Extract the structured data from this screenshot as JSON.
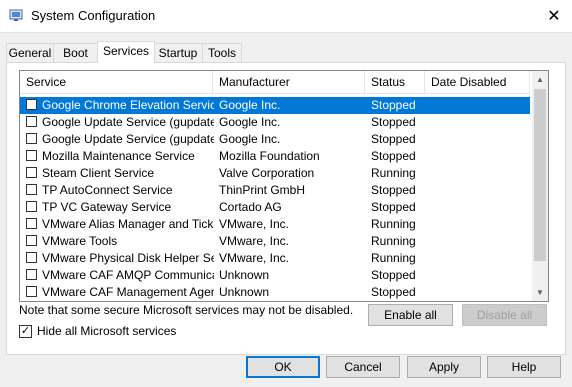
{
  "window": {
    "title": "System Configuration",
    "close_glyph": "✕"
  },
  "tabs": [
    {
      "label": "General"
    },
    {
      "label": "Boot"
    },
    {
      "label": "Services"
    },
    {
      "label": "Startup"
    },
    {
      "label": "Tools"
    }
  ],
  "active_tab": "Services",
  "table": {
    "columns": [
      "Service",
      "Manufacturer",
      "Status",
      "Date Disabled"
    ],
    "rows": [
      {
        "service": "Google Chrome Elevation Service",
        "manufacturer": "Google Inc.",
        "status": "Stopped",
        "date": "",
        "checked": false,
        "selected": true
      },
      {
        "service": "Google Update Service (gupdate)",
        "manufacturer": "Google Inc.",
        "status": "Stopped",
        "date": "",
        "checked": false
      },
      {
        "service": "Google Update Service (gupdatem)",
        "manufacturer": "Google Inc.",
        "status": "Stopped",
        "date": "",
        "checked": false
      },
      {
        "service": "Mozilla Maintenance Service",
        "manufacturer": "Mozilla Foundation",
        "status": "Stopped",
        "date": "",
        "checked": false
      },
      {
        "service": "Steam Client Service",
        "manufacturer": "Valve Corporation",
        "status": "Running",
        "date": "",
        "checked": false
      },
      {
        "service": "TP AutoConnect Service",
        "manufacturer": "ThinPrint GmbH",
        "status": "Stopped",
        "date": "",
        "checked": false
      },
      {
        "service": "TP VC Gateway Service",
        "manufacturer": "Cortado AG",
        "status": "Stopped",
        "date": "",
        "checked": false
      },
      {
        "service": "VMware Alias Manager and Ticke...",
        "manufacturer": "VMware, Inc.",
        "status": "Running",
        "date": "",
        "checked": false
      },
      {
        "service": "VMware Tools",
        "manufacturer": "VMware, Inc.",
        "status": "Running",
        "date": "",
        "checked": false
      },
      {
        "service": "VMware Physical Disk Helper Ser...",
        "manufacturer": "VMware, Inc.",
        "status": "Running",
        "date": "",
        "checked": false
      },
      {
        "service": "VMware CAF AMQP Communicati...",
        "manufacturer": "Unknown",
        "status": "Stopped",
        "date": "",
        "checked": false
      },
      {
        "service": "VMware CAF Management Agen...",
        "manufacturer": "Unknown",
        "status": "Stopped",
        "date": "",
        "checked": false
      }
    ]
  },
  "scroll": {
    "up_glyph": "▲",
    "down_glyph": "▼"
  },
  "note": "Note that some secure Microsoft services may not be disabled.",
  "enable_all": "Enable all",
  "disable_all": "Disable all",
  "hide_ms": {
    "label": "Hide all Microsoft services",
    "checked": true,
    "check_glyph": "✓"
  },
  "buttons": {
    "ok": "OK",
    "cancel": "Cancel",
    "apply": "Apply",
    "help": "Help"
  },
  "colors": {
    "selection": "#0078d7",
    "dialog_bg": "#f0f0f0"
  }
}
